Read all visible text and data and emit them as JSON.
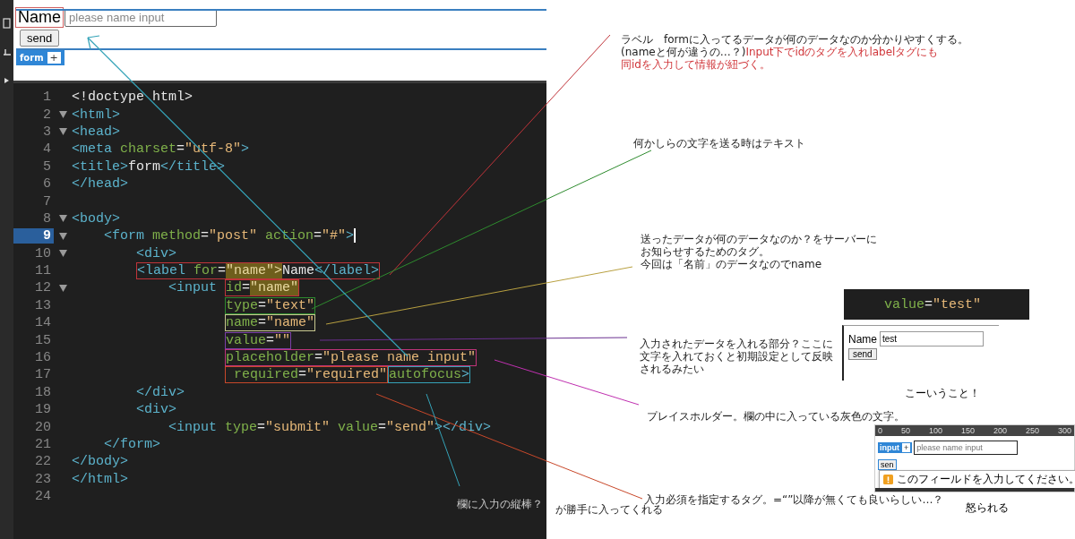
{
  "preview": {
    "label": "Name",
    "placeholder": "please name input",
    "button": "send",
    "tag_badge": "form",
    "tag_add": "+"
  },
  "editor": {
    "lines": [
      {
        "number": "1",
        "fold": false,
        "current": false,
        "tokens": [
          {
            "kind": "plain",
            "text": "<!doctype html>"
          }
        ]
      },
      {
        "number": "2",
        "fold": true,
        "current": false,
        "tokens": [
          {
            "kind": "tag",
            "text": "<html>"
          }
        ]
      },
      {
        "number": "3",
        "fold": true,
        "current": false,
        "tokens": [
          {
            "kind": "tag",
            "text": "<head>"
          }
        ]
      },
      {
        "number": "4",
        "fold": false,
        "current": false,
        "tokens": [
          {
            "kind": "tag",
            "text": "<meta "
          },
          {
            "kind": "attr",
            "text": "charset"
          },
          {
            "kind": "text",
            "text": "="
          },
          {
            "kind": "string",
            "text": "\"utf-8\""
          },
          {
            "kind": "tag",
            "text": ">"
          }
        ]
      },
      {
        "number": "5",
        "fold": false,
        "current": false,
        "tokens": [
          {
            "kind": "tag",
            "text": "<title>"
          },
          {
            "kind": "text",
            "text": "form"
          },
          {
            "kind": "tag",
            "text": "</title>"
          }
        ]
      },
      {
        "number": "6",
        "fold": false,
        "current": false,
        "tokens": [
          {
            "kind": "tag",
            "text": "</head>"
          }
        ]
      },
      {
        "number": "7",
        "fold": false,
        "current": false
      },
      {
        "number": "8",
        "fold": true,
        "current": false,
        "tokens": [
          {
            "kind": "tag",
            "text": "<body>"
          }
        ],
        "children": [
          {
            "number": "9",
            "fold": true,
            "current": true,
            "tokens": [
              {
                "kind": "tag",
                "text": "<form "
              },
              {
                "kind": "attr",
                "text": "method"
              },
              {
                "kind": "text",
                "text": "="
              },
              {
                "kind": "string",
                "text": "\"post\""
              },
              {
                "kind": "attr",
                "text": " action"
              },
              {
                "kind": "text",
                "text": "="
              },
              {
                "kind": "string",
                "text": "\"#\""
              },
              {
                "kind": "tag",
                "text": ">"
              }
            ],
            "children": [
              {
                "number": "10",
                "fold": true,
                "current": false,
                "tokens": [
                  {
                    "kind": "tag",
                    "text": "<div>"
                  }
                ]
              },
              {
                "number": "11",
                "fold": false,
                "current": false,
                "tokens": [
                  {
                    "kind": "box",
                    "color": "#c0343a",
                    "tokens": [
                      {
                        "kind": "tag",
                        "text": "<label "
                      },
                      {
                        "kind": "attr",
                        "text": "for"
                      },
                      {
                        "kind": "text",
                        "text": "="
                      },
                      {
                        "kind": "match",
                        "text": "\"name\">"
                      },
                      {
                        "kind": "text",
                        "text": "Name"
                      },
                      {
                        "kind": "tag",
                        "text": "</label>"
                      }
                    ]
                  }
                ],
                "children": [
                  {
                    "number": "12",
                    "fold": true,
                    "current": false,
                    "tokens": [
                      {
                        "kind": "tag",
                        "text": "<input "
                      },
                      {
                        "kind": "box",
                        "color": "#c0343a",
                        "tokens": [
                          {
                            "kind": "attr",
                            "text": "id"
                          },
                          {
                            "kind": "text",
                            "text": "="
                          },
                          {
                            "kind": "match",
                            "text": "\"name\""
                          }
                        ]
                      }
                    ],
                    "children": [
                      {
                        "number": "13",
                        "kind": "continuation",
                        "fold": false,
                        "current": false,
                        "tokens": [
                          {
                            "kind": "box",
                            "color": "#2e8b2e",
                            "tokens": [
                              {
                                "kind": "attr",
                                "text": "type"
                              },
                              {
                                "kind": "text",
                                "text": "="
                              },
                              {
                                "kind": "string",
                                "text": "\"text\""
                              }
                            ]
                          }
                        ]
                      },
                      {
                        "number": "14",
                        "kind": "continuation",
                        "fold": false,
                        "current": false,
                        "tokens": [
                          {
                            "kind": "box",
                            "color": "#c8c890",
                            "tokens": [
                              {
                                "kind": "attr",
                                "text": "name"
                              },
                              {
                                "kind": "text",
                                "text": "="
                              },
                              {
                                "kind": "string",
                                "text": "\"name\""
                              }
                            ]
                          }
                        ]
                      },
                      {
                        "number": "15",
                        "kind": "continuation",
                        "fold": false,
                        "current": false,
                        "tokens": [
                          {
                            "kind": "box",
                            "color": "#7b3fa8",
                            "tokens": [
                              {
                                "kind": "attr",
                                "text": "value"
                              },
                              {
                                "kind": "text",
                                "text": "="
                              },
                              {
                                "kind": "string",
                                "text": "\"\""
                              }
                            ]
                          }
                        ]
                      },
                      {
                        "number": "16",
                        "kind": "continuation",
                        "fold": false,
                        "current": false,
                        "tokens": [
                          {
                            "kind": "box",
                            "color": "#c0347a",
                            "tokens": [
                              {
                                "kind": "attr",
                                "text": "placeholder"
                              },
                              {
                                "kind": "text",
                                "text": "="
                              },
                              {
                                "kind": "string",
                                "text": "\"please name input\""
                              }
                            ]
                          }
                        ]
                      },
                      {
                        "number": "17",
                        "kind": "continuation",
                        "fold": false,
                        "current": false,
                        "tokens": [
                          {
                            "kind": "box",
                            "color": "#c8482a",
                            "tokens": [
                              {
                                "kind": "attr",
                                "text": " required"
                              },
                              {
                                "kind": "text",
                                "text": "="
                              },
                              {
                                "kind": "string",
                                "text": "\"required\""
                              }
                            ]
                          },
                          {
                            "kind": "box",
                            "color": "#35a3b8",
                            "tokens": [
                              {
                                "kind": "attr",
                                "text": "autofocus"
                              },
                              {
                                "kind": "tag",
                                "text": ">"
                              }
                            ]
                          }
                        ]
                      }
                    ]
                  }
                ]
              },
              {
                "number": "18",
                "fold": false,
                "current": false,
                "tokens": [
                  {
                    "kind": "tag",
                    "text": "</div>"
                  }
                ]
              },
              {
                "number": "19",
                "fold": false,
                "current": false,
                "tokens": [
                  {
                    "kind": "tag",
                    "text": "<div>"
                  }
                ],
                "children": [
                  {
                    "number": "20",
                    "fold": false,
                    "current": false,
                    "tokens": [
                      {
                        "kind": "tag",
                        "text": "<input "
                      },
                      {
                        "kind": "attr",
                        "text": "type"
                      },
                      {
                        "kind": "text",
                        "text": "="
                      },
                      {
                        "kind": "string",
                        "text": "\"submit\""
                      },
                      {
                        "kind": "attr",
                        "text": " value"
                      },
                      {
                        "kind": "text",
                        "text": "="
                      },
                      {
                        "kind": "string",
                        "text": "\"send\""
                      },
                      {
                        "kind": "tag",
                        "text": "></div>"
                      }
                    ]
                  }
                ]
              }
            ]
          },
          {
            "number": "21",
            "fold": false,
            "current": false,
            "tokens": [
              {
                "kind": "tag",
                "text": "</form>"
              }
            ]
          }
        ]
      },
      {
        "number": "22",
        "fold": false,
        "current": false,
        "tokens": [
          {
            "kind": "tag",
            "text": "</body>"
          }
        ]
      },
      {
        "number": "23",
        "fold": false,
        "current": false,
        "tokens": [
          {
            "kind": "tag",
            "text": "</html>"
          }
        ]
      },
      {
        "number": "24",
        "fold": false,
        "current": false
      }
    ],
    "overlay_note": "欄に入力の縦棒？"
  },
  "annotations": [
    {
      "lines": [
        [
          {
            "text": "ラベル　formに入ってるデータが何のデータなのか分かりやすくする。",
            "color": "#222222"
          }
        ],
        [
          {
            "text": "(nameと何が違うの…？)",
            "color": "#222222"
          },
          {
            "text": "Input下でidのタグを入れlabelタグにも",
            "color": "#d0363a"
          }
        ],
        [
          {
            "text": "同idを入力して情報が紐づく。",
            "color": "#d0363a"
          }
        ]
      ]
    },
    {
      "lines": [
        [
          {
            "text": "何かしらの文字を送る時はテキスト"
          }
        ]
      ]
    },
    {
      "lines": [
        [
          {
            "text": "送ったデータが何のデータなのか？をサーバーに"
          }
        ],
        [
          {
            "text": "お知らせするためのタグ。"
          }
        ],
        [
          {
            "text": "今回は「名前」のデータなのでname"
          }
        ]
      ]
    },
    {
      "lines": [
        [
          {
            "text": "入力されたデータを入れる部分？ここに"
          }
        ],
        [
          {
            "text": "文字を入れておくと初期設定として反映"
          }
        ],
        [
          {
            "text": "されるみたい"
          }
        ]
      ]
    },
    {
      "lines": [
        [
          {
            "text": "プレイスホルダー。欄の中に入っている灰色の文字。"
          }
        ]
      ]
    },
    {
      "lines": [
        [
          {
            "text": "入力必須を指定するタグ。=“”以降が無くても良いらしい…？"
          }
        ]
      ]
    },
    {
      "lines": [
        [
          {
            "text": "が勝手に入ってくれる"
          }
        ]
      ]
    }
  ],
  "example_value": {
    "code": [
      {
        "kind": "attr",
        "text": "value"
      },
      {
        "kind": "text",
        "text": "="
      },
      {
        "kind": "string",
        "text": "\"test\""
      }
    ],
    "label": "Name",
    "value": "test",
    "button": "send",
    "caption": "こーいうこと！"
  },
  "example_required": {
    "ruler": [
      "0",
      "50",
      "100",
      "150",
      "200",
      "250",
      "300"
    ],
    "tag_badge": "input",
    "tag_add": "+",
    "placeholder": "please name input",
    "button": "sen",
    "message": "このフィールドを入力してください。",
    "caption": "怒られる"
  }
}
